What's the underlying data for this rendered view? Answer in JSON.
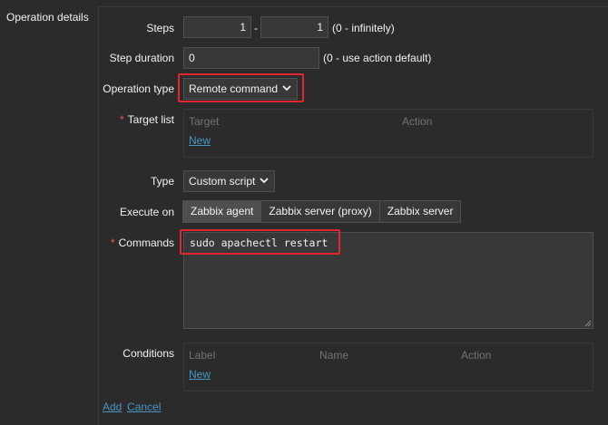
{
  "section": {
    "label": "Operation details"
  },
  "steps": {
    "label": "Steps",
    "from": "1",
    "separator": "-",
    "to": "1",
    "hint": "(0 - infinitely)"
  },
  "step_duration": {
    "label": "Step duration",
    "value": "0",
    "hint": "(0 - use action default)"
  },
  "operation_type": {
    "label": "Operation type",
    "value": "Remote command"
  },
  "target_list": {
    "required": "*",
    "label": "Target list",
    "col_target": "Target",
    "col_action": "Action",
    "new_link": "New"
  },
  "type": {
    "label": "Type",
    "value": "Custom script"
  },
  "execute_on": {
    "label": "Execute on",
    "options": [
      "Zabbix agent",
      "Zabbix server (proxy)",
      "Zabbix server"
    ],
    "selected": "Zabbix agent"
  },
  "commands": {
    "required": "*",
    "label": "Commands",
    "value": "sudo apachectl restart"
  },
  "conditions": {
    "label": "Conditions",
    "col_label": "Label",
    "col_name": "Name",
    "col_action": "Action",
    "new_link": "New"
  },
  "footer": {
    "add": "Add",
    "cancel": "Cancel"
  },
  "colors": {
    "link": "#4796c4",
    "highlight": "#e0262e",
    "required": "#e45959"
  }
}
